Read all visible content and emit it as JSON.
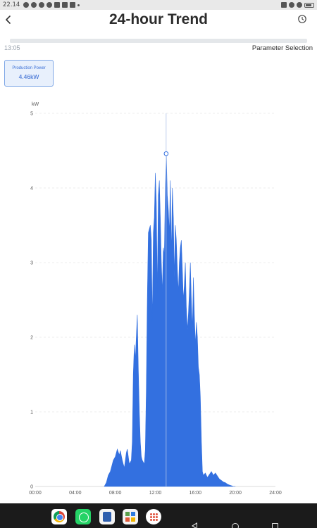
{
  "status_bar": {
    "time": "22.14"
  },
  "header": {
    "title": "24-hour Trend",
    "back_icon": "chevron-left-icon",
    "history_icon": "history-icon"
  },
  "toolbar": {
    "time": "13:05",
    "parameter_selection": "Parameter Selection"
  },
  "parameter_card": {
    "label": "Production Power",
    "value": "4.46kW"
  },
  "chart_data": {
    "type": "area",
    "title": "",
    "ylabel": "kW",
    "xlabel": "",
    "ylim": [
      0,
      5
    ],
    "xlim": [
      0,
      24
    ],
    "y_ticks": [
      "0",
      "1",
      "2",
      "3",
      "4",
      "5"
    ],
    "x_ticks": [
      "00:00",
      "04:00",
      "08:00",
      "12:00",
      "16:00",
      "20:00",
      "24:00"
    ],
    "x_tick_values": [
      0,
      4,
      8,
      12,
      16,
      20,
      24
    ],
    "grid": "horizontal-dashed",
    "cursor": {
      "x": 13.08,
      "y": 4.46
    },
    "series": [
      {
        "color": "#3370e0",
        "x": [
          6.9,
          7.1,
          7.3,
          7.5,
          7.7,
          7.8,
          8.0,
          8.1,
          8.2,
          8.4,
          8.5,
          8.7,
          8.8,
          8.9,
          9.1,
          9.2,
          9.4,
          9.6,
          9.7,
          9.8,
          9.9,
          10.0,
          10.2,
          10.3,
          10.4,
          10.5,
          10.6,
          10.7,
          10.9,
          11.0,
          11.1,
          11.2,
          11.3,
          11.5,
          11.6,
          11.7,
          11.8,
          11.9,
          12.0,
          12.1,
          12.2,
          12.3,
          12.4,
          12.5,
          12.6,
          12.7,
          12.8,
          12.9,
          13.0,
          13.1,
          13.2,
          13.3,
          13.4,
          13.5,
          13.6,
          13.7,
          13.8,
          13.9,
          14.0,
          14.1,
          14.2,
          14.3,
          14.4,
          14.5,
          14.6,
          14.7,
          14.8,
          14.9,
          15.0,
          15.1,
          15.2,
          15.3,
          15.4,
          15.5,
          15.6,
          15.7,
          15.8,
          15.9,
          16.0,
          16.1,
          16.2,
          16.3,
          16.4,
          16.5,
          16.6,
          16.7,
          16.8,
          17.0,
          17.2,
          17.4,
          17.6,
          17.8,
          18.0,
          18.2,
          18.4,
          18.6,
          18.8,
          19.0,
          19.2,
          19.4,
          19.6,
          19.8,
          20.0
        ],
        "values": [
          0,
          0.05,
          0.15,
          0.2,
          0.3,
          0.35,
          0.4,
          0.45,
          0.5,
          0.42,
          0.48,
          0.35,
          0.3,
          0.25,
          0.45,
          0.5,
          0.3,
          0.35,
          0.6,
          1.5,
          1.9,
          1.7,
          2.3,
          1.6,
          1.0,
          0.6,
          0.4,
          0.35,
          0.3,
          0.5,
          1.3,
          2.5,
          3.4,
          3.5,
          3.3,
          2.2,
          3.4,
          3.6,
          4.2,
          3.8,
          2.6,
          3.9,
          4.1,
          3.6,
          3.0,
          2.6,
          3.2,
          3.1,
          4.0,
          4.46,
          3.9,
          3.7,
          3.4,
          4.1,
          3.1,
          4.0,
          3.6,
          2.8,
          3.5,
          3.3,
          2.9,
          2.6,
          3.0,
          3.2,
          3.3,
          2.9,
          2.5,
          2.7,
          3.0,
          2.4,
          2.1,
          2.3,
          2.6,
          3.0,
          2.5,
          2.1,
          2.8,
          2.3,
          1.9,
          2.2,
          2.0,
          1.6,
          1.5,
          1.2,
          0.6,
          0.2,
          0.15,
          0.18,
          0.12,
          0.16,
          0.2,
          0.15,
          0.18,
          0.14,
          0.1,
          0.08,
          0.06,
          0.05,
          0.03,
          0.02,
          0.01,
          0,
          0
        ]
      }
    ]
  }
}
